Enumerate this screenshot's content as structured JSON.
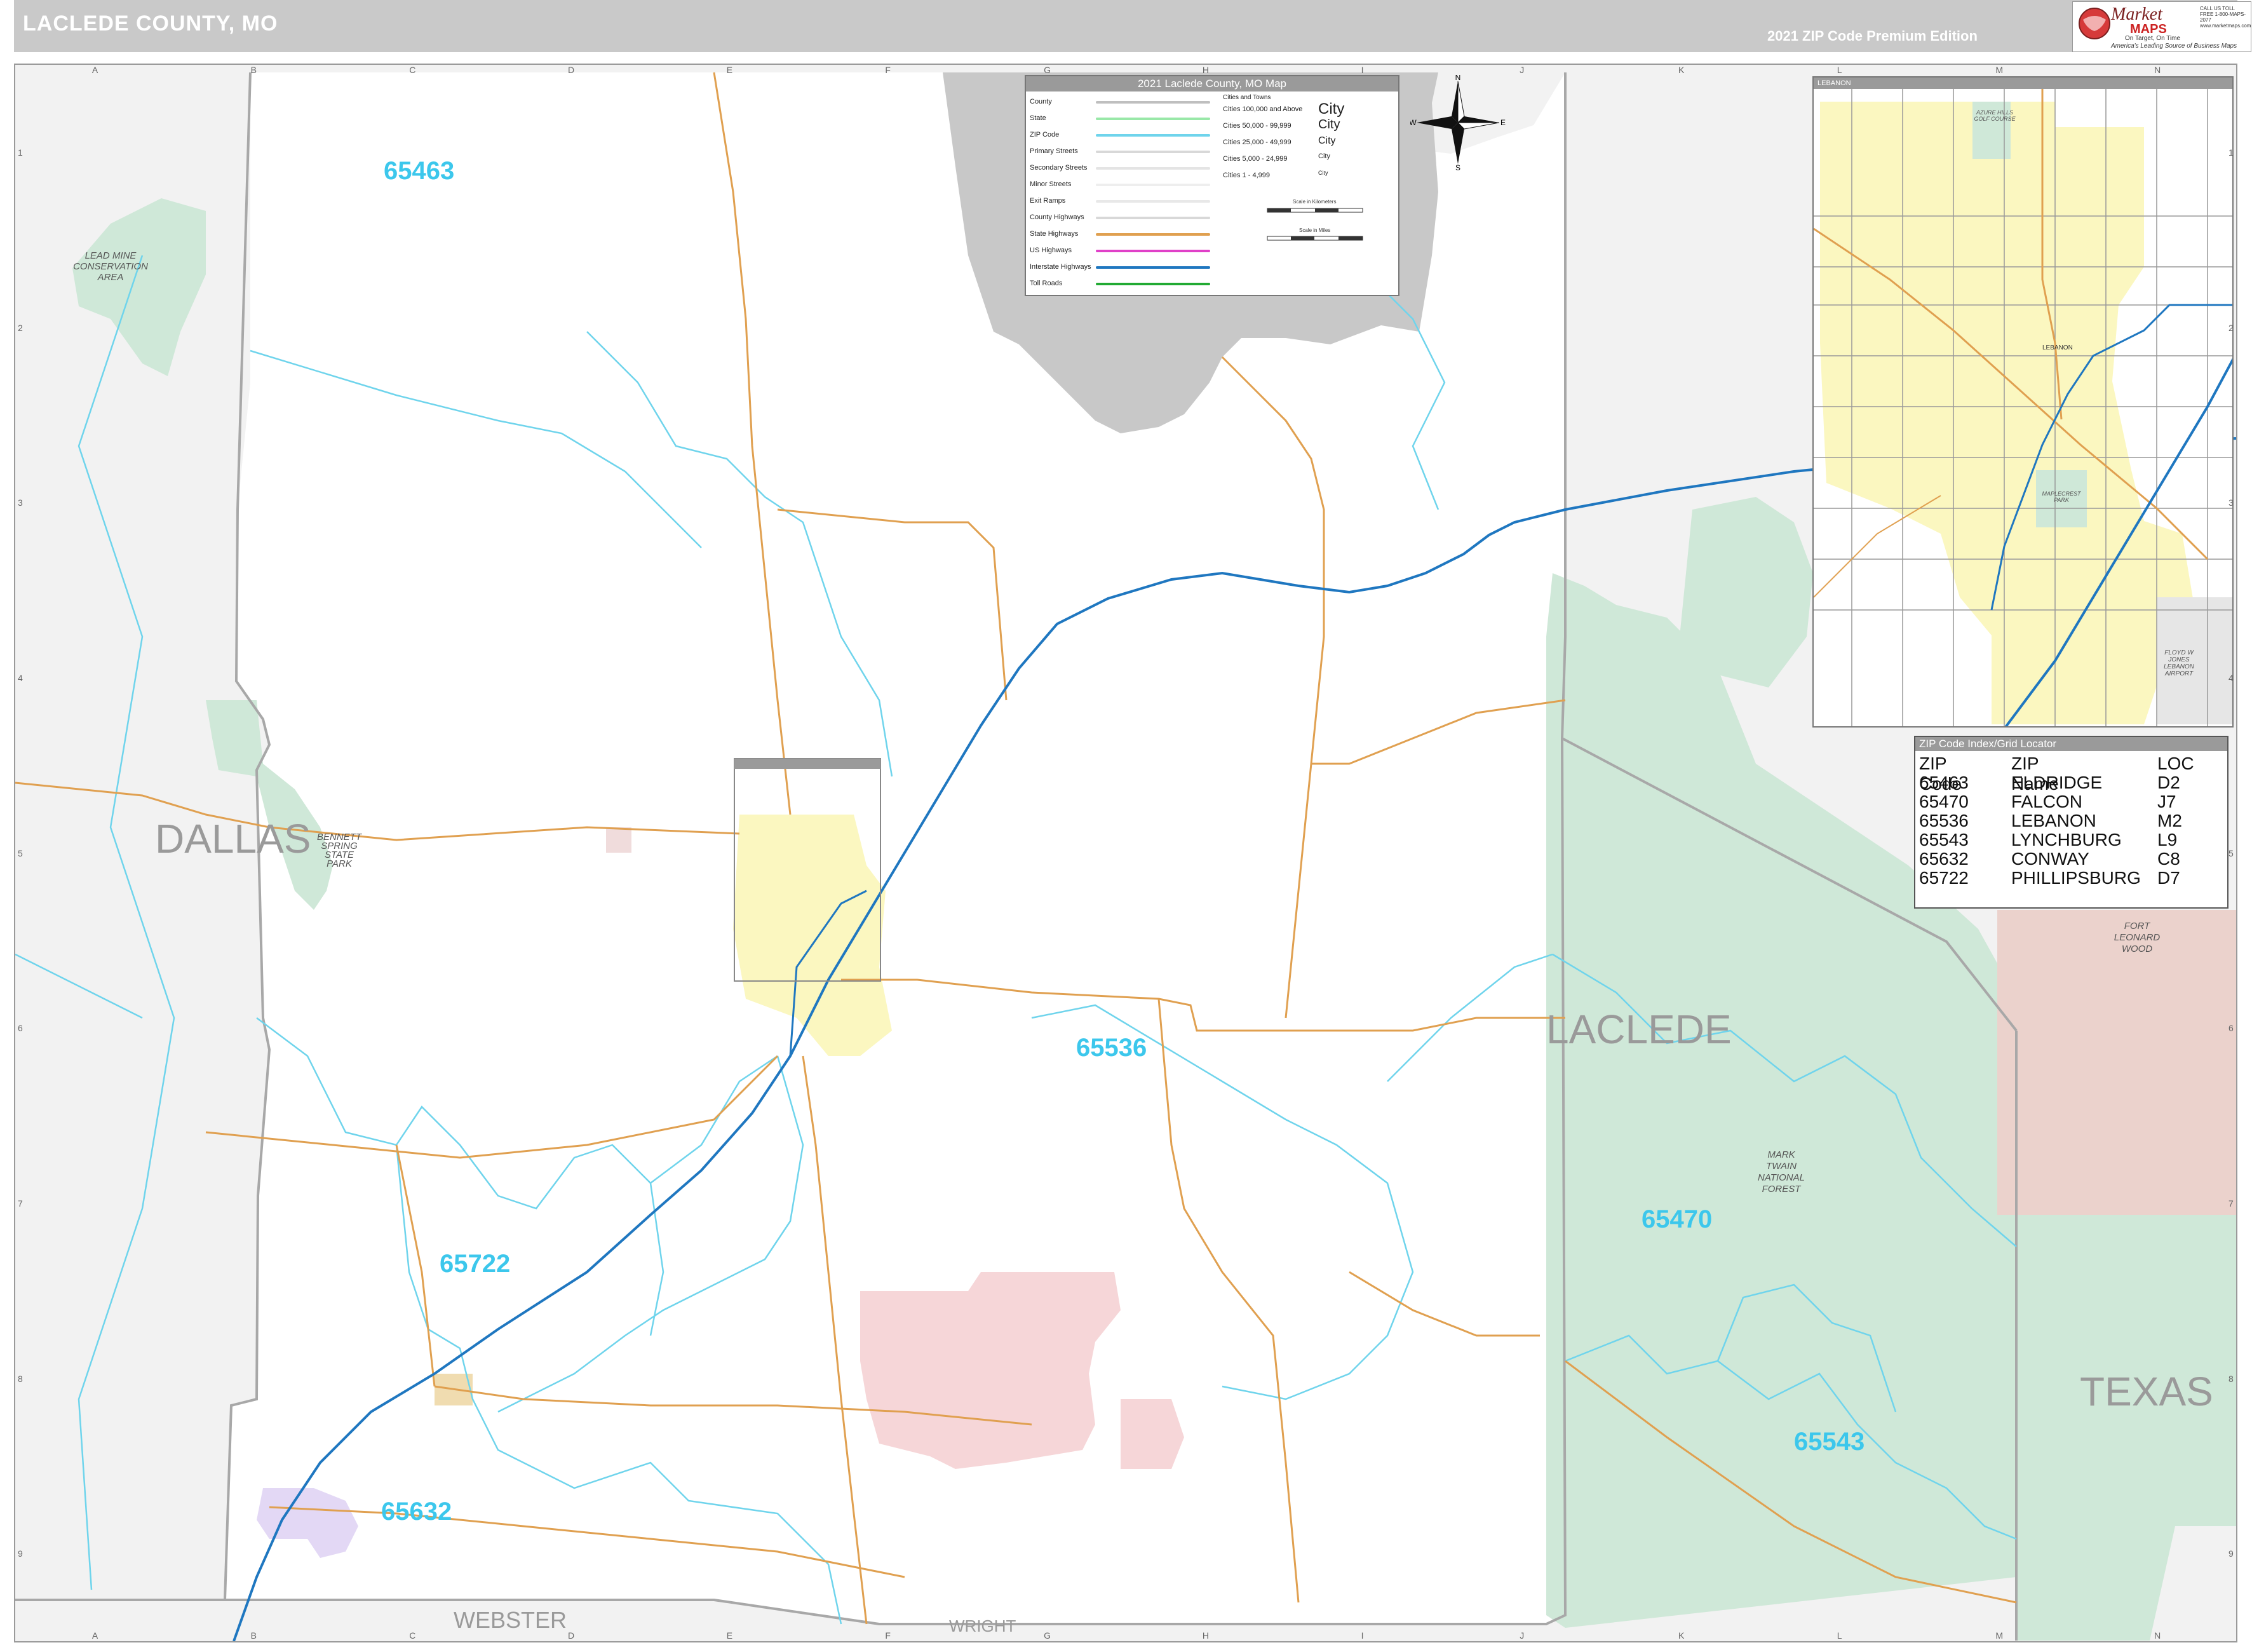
{
  "header": {
    "title": "LACLEDE COUNTY, MO",
    "edition": "2021 ZIP Code Premium Edition"
  },
  "logo": {
    "word1": "Market",
    "word2": "MAPS",
    "tagline1": "On Target, On Time",
    "tagline2": "America's Leading Source of Business Maps",
    "contact": "CALL US TOLL FREE 1-800-MAPS-2077 www.marketmaps.com",
    "colors": {
      "word1": "#7a1f1f",
      "word2": "#cc2222"
    }
  },
  "grid": {
    "columns": [
      "A",
      "B",
      "C",
      "D",
      "E",
      "F",
      "G",
      "H",
      "I",
      "J",
      "K",
      "L",
      "M",
      "N"
    ],
    "rows": [
      "1",
      "2",
      "3",
      "4",
      "5",
      "6",
      "7",
      "8",
      "9"
    ]
  },
  "regions": {
    "neighbors": [
      "DALLAS",
      "LACLEDE",
      "TEXAS",
      "WEBSTER",
      "WRIGHT"
    ],
    "zips": [
      "65463",
      "65536",
      "65722",
      "65632",
      "65470",
      "65543"
    ],
    "areas": {
      "lead_mine": [
        "LEAD MINE",
        "CONSERVATION",
        "AREA"
      ],
      "bennett": [
        "BENNETT",
        "SPRING",
        "STATE",
        "PARK"
      ],
      "mark_twain": [
        "MARK",
        "TWAIN",
        "NATIONAL",
        "FOREST"
      ],
      "fort": [
        "FORT",
        "LEONARD",
        "WOOD"
      ]
    }
  },
  "colors": {
    "zip_boundary": "#6fd4ec",
    "zip_label": "#3cc7ec",
    "state_highway": "#e0a050",
    "interstate": "#1f77c0",
    "forest": "#cfe8d8",
    "park": "#cfe8d8",
    "city": "#fbf7c0",
    "military": "#ebd2cc",
    "restricted": "#f6d6d8",
    "outside_county": "#f2f2f2",
    "lake_of_ozarks": "#c8c8c8",
    "conway_city": "#e3d8f5"
  },
  "legend": {
    "title": "2021 Laclede County, MO Map",
    "items": [
      {
        "label": "County",
        "color": "#bfbfbf"
      },
      {
        "label": "State",
        "color": "#99e8a8"
      },
      {
        "label": "ZIP Code",
        "color": "#6fd4ec"
      },
      {
        "label": "Primary Streets",
        "color": "#d8d8d8"
      },
      {
        "label": "Secondary Streets",
        "color": "#e4e4e4"
      },
      {
        "label": "Minor Streets",
        "color": "#eeeeee"
      },
      {
        "label": "Exit Ramps",
        "color": "#e8e8e8"
      },
      {
        "label": "County Highways",
        "color": "#d8d8d8"
      },
      {
        "label": "State Highways",
        "color": "#e0a050"
      },
      {
        "label": "US Highways",
        "color": "#e040c8"
      },
      {
        "label": "Interstate Highways",
        "color": "#1f77c0"
      },
      {
        "label": "Toll Roads",
        "color": "#22aa33"
      }
    ],
    "cities_title": "Cities and Towns",
    "cities": [
      {
        "label": "Cities 100,000 and Above",
        "sample": "City"
      },
      {
        "label": "Cities 50,000 - 99,999",
        "sample": "City"
      },
      {
        "label": "Cities 25,000 - 49,999",
        "sample": "City"
      },
      {
        "label": "Cities 5,000 - 24,999",
        "sample": "City"
      },
      {
        "label": "Cities 1 - 4,999",
        "sample": "City"
      }
    ],
    "scale_km": "Scale in Kilometers",
    "scale_mi": "Scale in Miles"
  },
  "compass": {
    "n": "N",
    "s": "S",
    "e": "E",
    "w": "W"
  },
  "inset": {
    "title": "LEBANON",
    "labels": [
      "AZURE HILLS GOLF COURSE",
      "LEBANON",
      "MAPLECREST PARK",
      "FLOYD W JONES LEBANON AIRPORT"
    ]
  },
  "zip_index": {
    "title": "ZIP Code Index/Grid Locator",
    "headers": [
      "ZIP Code",
      "ZIP Name",
      "LOC"
    ],
    "rows": [
      [
        "65463",
        "ELDRIDGE",
        "D2"
      ],
      [
        "65470",
        "FALCON",
        "J7"
      ],
      [
        "65536",
        "LEBANON",
        "M2"
      ],
      [
        "65543",
        "LYNCHBURG",
        "L9"
      ],
      [
        "65632",
        "CONWAY",
        "C8"
      ],
      [
        "65722",
        "PHILLIPSBURG",
        "D7"
      ]
    ]
  }
}
